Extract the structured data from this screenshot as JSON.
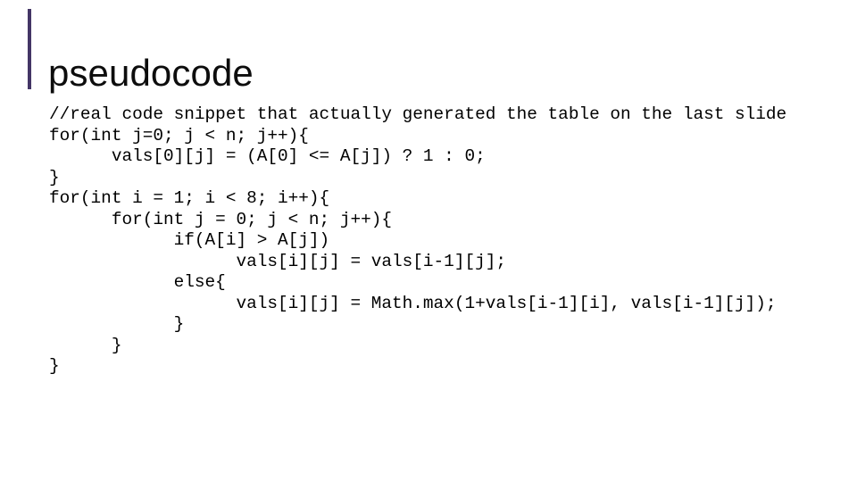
{
  "slide": {
    "title": "pseudocode",
    "accent_color": "#433566",
    "background_color": "#ffffff",
    "text_color": "#000000"
  },
  "code": {
    "language": "java",
    "lines": [
      "//real code snippet that actually generated the table on the last slide",
      "for(int j=0; j < n; j++){",
      "      vals[0][j] = (A[0] <= A[j]) ? 1 : 0;",
      "}",
      "for(int i = 1; i < 8; i++){",
      "      for(int j = 0; j < n; j++){",
      "            if(A[i] > A[j])",
      "                  vals[i][j] = vals[i-1][j];",
      "            else{",
      "                  vals[i][j] = Math.max(1+vals[i-1][i], vals[i-1][j]);",
      "            }",
      "      }",
      "}"
    ]
  }
}
